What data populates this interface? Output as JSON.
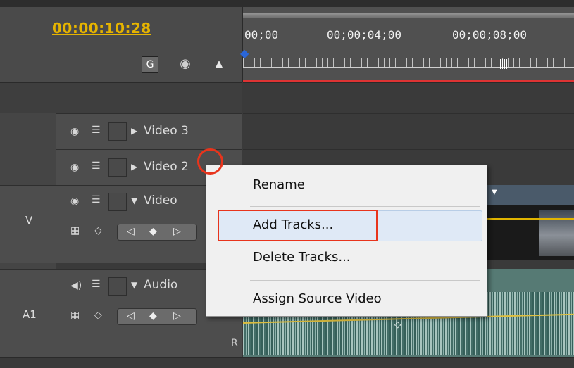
{
  "timecode": "00:00:10:28",
  "ruler": {
    "labels": [
      "00;00",
      "00;00;04;00",
      "00;00;08;00"
    ]
  },
  "tracks": {
    "video3_name": "Video 3",
    "video2_name": "Video 2",
    "video1_name": "Video",
    "audio1_name": "Audio",
    "v_label": "V",
    "a1_label": "A1",
    "r_label": "R"
  },
  "context_menu": {
    "items": [
      "Rename",
      "Add Tracks...",
      "Delete Tracks...",
      "Assign Source Video"
    ],
    "highlighted": "Add Tracks..."
  },
  "icons": {
    "snap": "snap-icon",
    "marker": "marker-icon",
    "keyframe": "keyframe-icon",
    "eye": "eye-icon",
    "film": "film-icon",
    "speaker": "speaker-icon"
  },
  "colors": {
    "timecode": "#e6b400",
    "highlight_box": "#e8341c",
    "work_area": "#dd3333"
  }
}
